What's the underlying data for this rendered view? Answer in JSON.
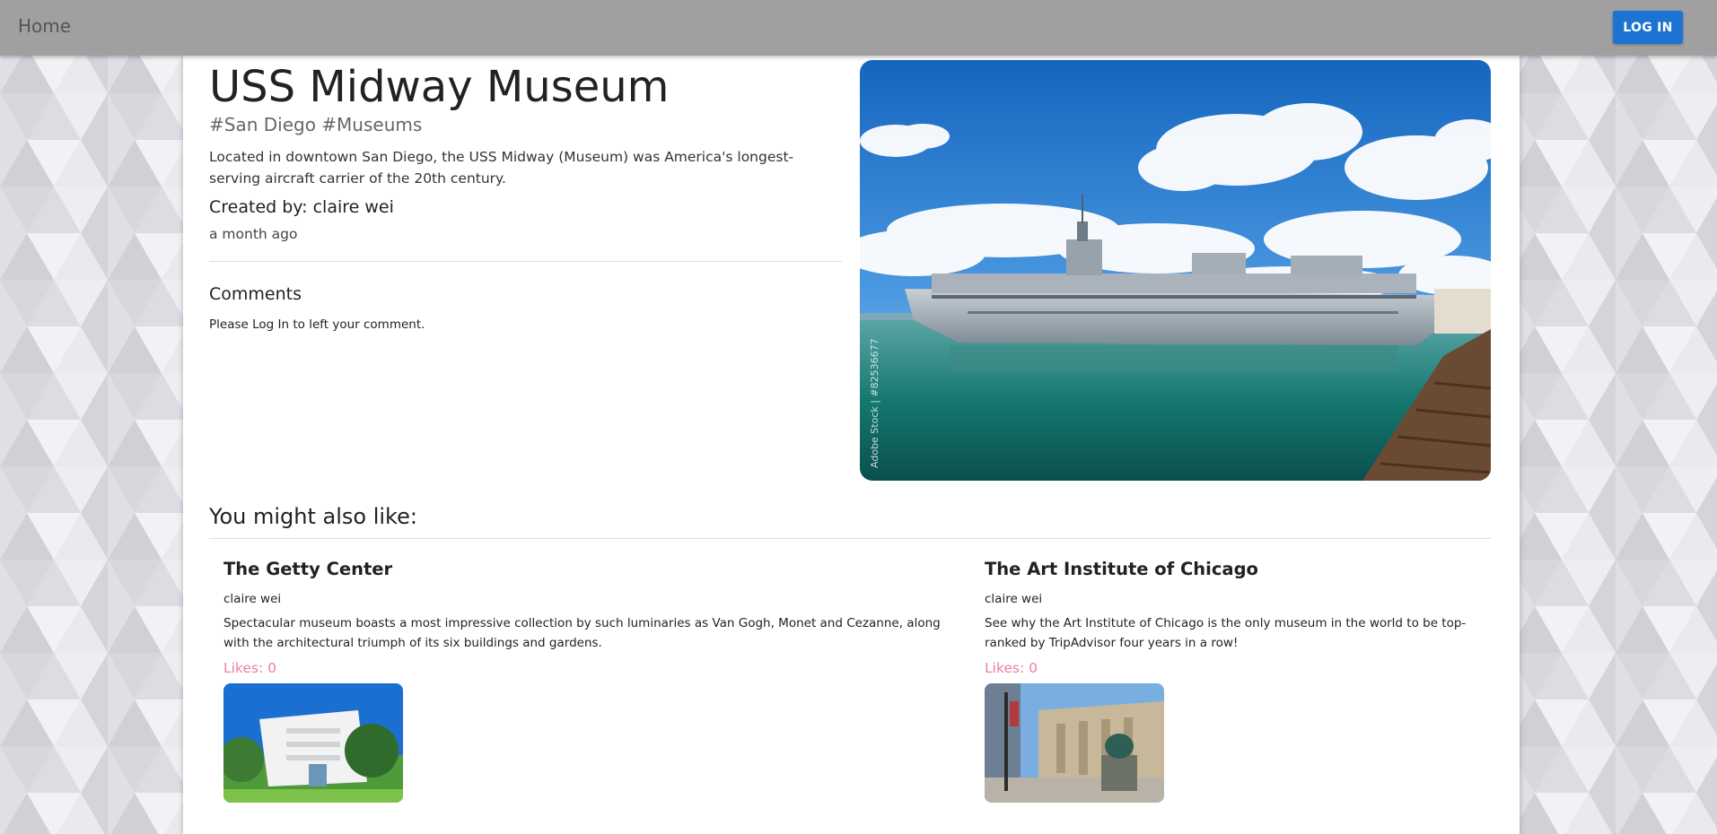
{
  "nav": {
    "home_label": "Home",
    "login_label": "LOG IN"
  },
  "post": {
    "title": "USS Midway Museum",
    "tags": "#San Diego #Museums",
    "description": "Located in downtown San Diego, the USS Midway (Museum) was America's longest-serving aircraft carrier of the 20th century.",
    "created_by": "Created by: claire wei",
    "time_ago": "a month ago",
    "image_alt": "USS Midway aircraft carrier docked in San Diego bay",
    "image_watermark": "Adobe Stock | #82536677"
  },
  "comments": {
    "heading": "Comments",
    "note_prefix": "Please ",
    "note_link": "Log In",
    "note_suffix": " to left your comment."
  },
  "recommendations": {
    "heading": "You might also like:",
    "items": [
      {
        "title": "The Getty Center",
        "author": "claire wei",
        "description": "Spectacular museum boasts a most impressive collection by such luminaries as Van Gogh, Monet and Cezanne, along with the architectural triumph of its six buildings and gardens.",
        "likes": "Likes: 0"
      },
      {
        "title": "The Art Institute of Chicago",
        "author": "claire wei",
        "description": "See why the Art Institute of Chicago is the only museum in the world to be top-ranked by TripAdvisor four years in a row!",
        "likes": "Likes: 0"
      }
    ]
  },
  "colors": {
    "navbar": "#a0a0a0",
    "login_button": "#1d73d1",
    "likes": "#ea7fa9",
    "background": "#e7e8ec"
  }
}
